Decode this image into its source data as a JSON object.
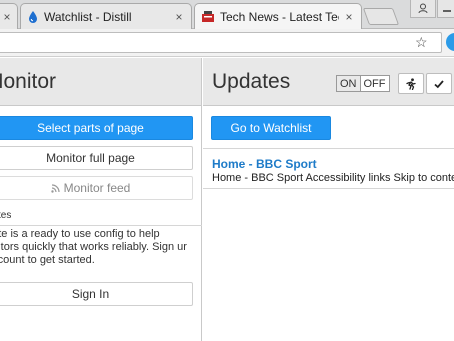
{
  "browser": {
    "tabs": [
      {
        "label": ""
      },
      {
        "label": "Watchlist - Distill"
      },
      {
        "label": "Tech News - Latest Techn"
      }
    ],
    "close_glyph": "×",
    "star_glyph": "☆"
  },
  "monitor_panel": {
    "title": "Monitor",
    "select_parts_label": "Select parts of page",
    "monitor_full_page_label": "Monitor full page",
    "monitor_feed_label": "Monitor feed",
    "section_label": "tes",
    "info_text": "date is a ready to use config to help onitors quickly that works reliably. Sign ur account to get started.",
    "sign_in_label": "Sign In"
  },
  "updates_panel": {
    "title": "Updates",
    "toggle_on": "ON",
    "toggle_off": "OFF",
    "go_to_watchlist_label": "Go to Watchlist",
    "items": [
      {
        "title": "Home - BBC Sport",
        "description": "Home - BBC Sport Accessibility links Skip to content"
      }
    ]
  },
  "colors": {
    "primary": "#2196f3",
    "link": "#1e7bc8",
    "panel_header": "#e8e8e8"
  },
  "icons": {
    "tab2_favicon": "water-drop-icon",
    "tab3_favicon": "news-favicon-icon",
    "feed": "rss-icon",
    "run": "running-man-icon",
    "check": "check-icon",
    "user": "user-icon",
    "extension": "distill-extension-icon"
  }
}
